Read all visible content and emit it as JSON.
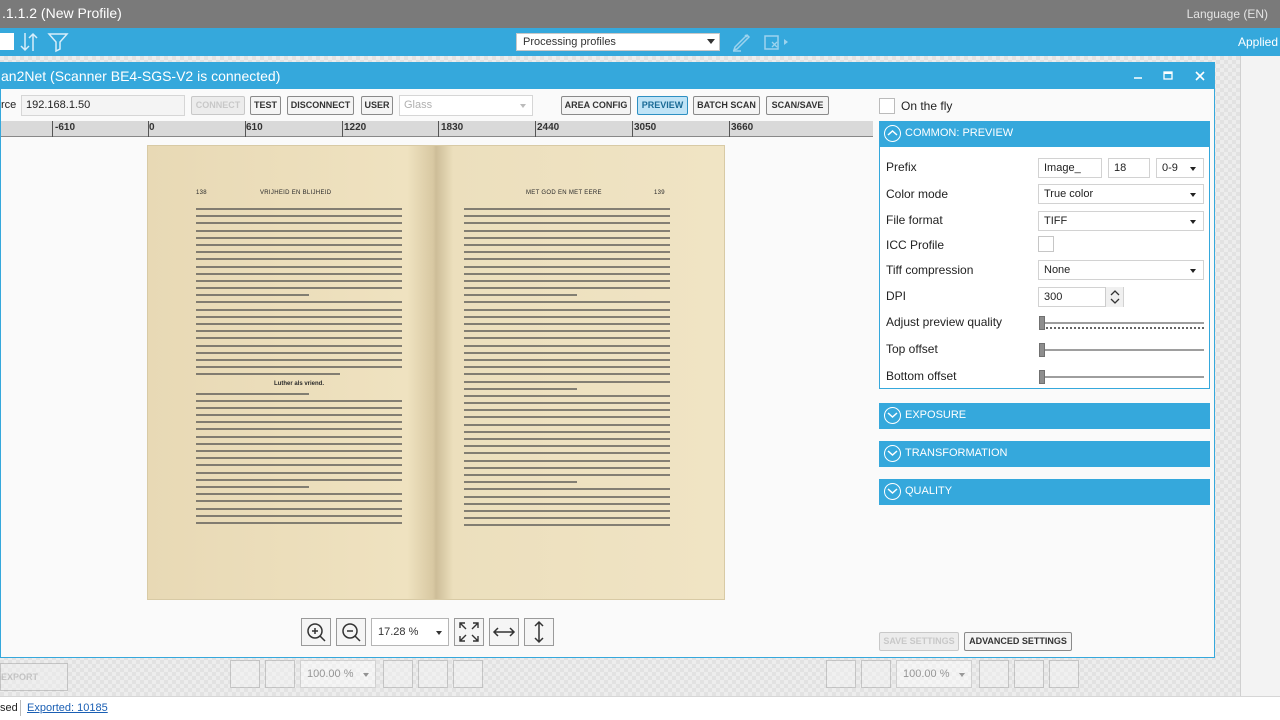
{
  "app": {
    "title": ".1.1.2 (New Profile)",
    "language": "Language (EN)",
    "processing_profiles": "Processing profiles",
    "applied": "Applied"
  },
  "dialog": {
    "title": "an2Net (Scanner BE4-SGS-V2 is connected)",
    "source_label": "rce",
    "ip": "192.168.1.50",
    "buttons": {
      "connect": "CONNECT",
      "test": "TEST",
      "disconnect": "DISCONNECT",
      "user": "USER",
      "area_config": "AREA CONFIG",
      "preview": "PREVIEW",
      "batch_scan": "BATCH SCAN",
      "scan_save": "SCAN/SAVE"
    },
    "glass": "Glass",
    "ruler": [
      "-610",
      "0",
      "610",
      "1220",
      "1830",
      "2440",
      "3050",
      "3660"
    ],
    "zoom": "17.28 %",
    "page_left_header": "VRIJHEID EN BLIJHEID",
    "page_left_num": "138",
    "page_right_header": "MET GOD EN MET EERE",
    "page_right_num": "139",
    "page_left_subtitle": "Luther als vriend."
  },
  "settings": {
    "on_the_fly": "On the fly",
    "common_preview": "COMMON: PREVIEW",
    "prefix_label": "Prefix",
    "prefix_value": "Image_",
    "prefix_num": "18",
    "prefix_digits": "0-9",
    "color_mode_label": "Color mode",
    "color_mode": "True color",
    "file_format_label": "File format",
    "file_format": "TIFF",
    "icc_label": "ICC Profile",
    "tiff_comp_label": "Tiff compression",
    "tiff_comp": "None",
    "dpi_label": "DPI",
    "dpi": "300",
    "adjust_label": "Adjust preview quality",
    "top_offset_label": "Top offset",
    "bottom_offset_label": "Bottom offset",
    "exposure": "EXPOSURE",
    "transformation": "TRANSFORMATION",
    "quality": "QUALITY",
    "save_settings": "SAVE SETTINGS",
    "advanced_settings": "ADVANCED SETTINGS"
  },
  "bottom": {
    "export": "EXPORT",
    "zoom_left": "100.00 %",
    "zoom_right": "100.00 %",
    "status_used": "sed",
    "status_exported": "Exported: 10185"
  },
  "colors": {
    "accent": "#35a8dc",
    "titlebar": "#7a7a7a"
  }
}
